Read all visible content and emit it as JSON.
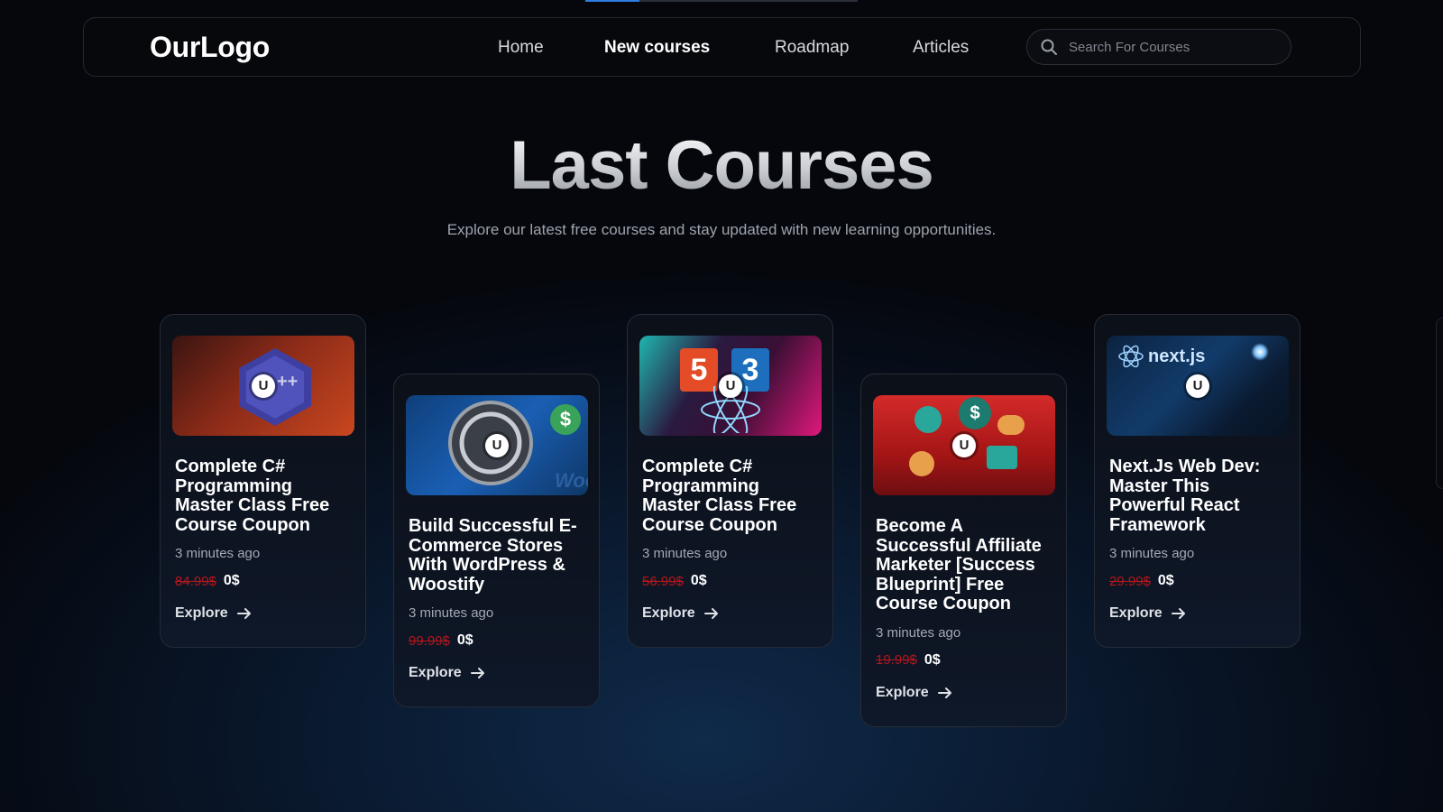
{
  "header": {
    "logo": "OurLogo",
    "nav": [
      {
        "label": "Home",
        "active": false
      },
      {
        "label": "New courses",
        "active": true
      },
      {
        "label": "Roadmap",
        "active": false
      },
      {
        "label": "Articles",
        "active": false
      }
    ],
    "search": {
      "placeholder": "Search For Courses",
      "icon": "search-icon"
    }
  },
  "hero": {
    "title": "Last Courses",
    "subtitle": "Explore our latest free courses and stay updated with new learning opportunities."
  },
  "courses": [
    {
      "title": "Complete C# Programming Master Class Free Course Coupon",
      "time": "3 minutes ago",
      "old_price": "84.99$",
      "price": "0$",
      "cta": "Explore",
      "thumb": "csharp"
    },
    {
      "title": "Build Successful E-Commerce Stores With WordPress & Woostify",
      "time": "3 minutes ago",
      "old_price": "99.99$",
      "price": "0$",
      "cta": "Explore",
      "thumb": "wordpress"
    },
    {
      "title": "Complete C# Programming Master Class Free Course Coupon",
      "time": "3 minutes ago",
      "old_price": "56.99$",
      "price": "0$",
      "cta": "Explore",
      "thumb": "html-css"
    },
    {
      "title": "Become A Successful Affiliate Marketer [Success Blueprint] Free Course Coupon",
      "time": "3 minutes ago",
      "old_price": "19.99$",
      "price": "0$",
      "cta": "Explore",
      "thumb": "affiliate"
    },
    {
      "title": "Next.Js Web Dev: Master This Powerful React Framework",
      "time": "3 minutes ago",
      "old_price": "29.99$",
      "price": "0$",
      "cta": "Explore",
      "thumb": "nextjs"
    }
  ],
  "thumb_badge": "U",
  "thumb_texts": {
    "wordpress_woo": "Woo",
    "nextjs_logo": "next.js",
    "html_5": "5",
    "css_3": "3",
    "csharp_plus": "++",
    "dollar": "$"
  },
  "colors": {
    "accent": "#2f7de1",
    "old_price": "#b3171c",
    "background": "#05070d"
  }
}
